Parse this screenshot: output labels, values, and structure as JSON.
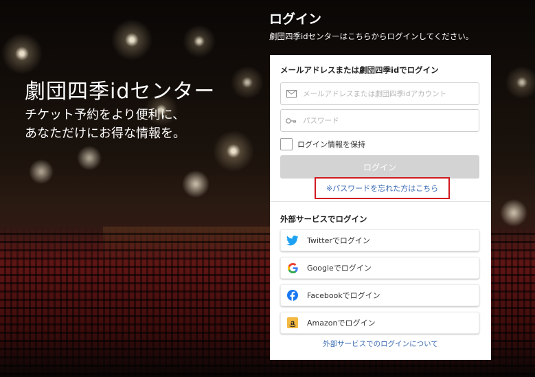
{
  "hero": {
    "title": "劇団四季idセンター",
    "subtitle_line1": "チケット予約をより便利に、",
    "subtitle_line2": "あなただけにお得な情報を。"
  },
  "login": {
    "heading": "ログイン",
    "description": "劇団四季idセンターはこちらからログインしてください。",
    "section_title": "メールアドレスまたは劇団四季idでログイン",
    "email_placeholder": "メールアドレスまたは劇団四季idアカウント",
    "password_placeholder": "パスワード",
    "remember_label": "ログイン情報を保持",
    "submit_label": "ログイン",
    "forgot_link": "※パスワードを忘れた方はこちら"
  },
  "external": {
    "section_title": "外部サービスでログイン",
    "buttons": [
      {
        "label": "Twitterでログイン",
        "icon": "twitter-icon"
      },
      {
        "label": "Googleでログイン",
        "icon": "google-icon"
      },
      {
        "label": "Facebookでログイン",
        "icon": "facebook-icon"
      },
      {
        "label": "Amazonでログイン",
        "icon": "amazon-icon"
      }
    ],
    "about_link": "外部サービスでのログインについて"
  },
  "colors": {
    "link": "#3d6db4",
    "highlight_box": "#d0191e",
    "disabled_button": "#d3d3d3",
    "twitter": "#1da1f2",
    "facebook": "#1877f2"
  }
}
